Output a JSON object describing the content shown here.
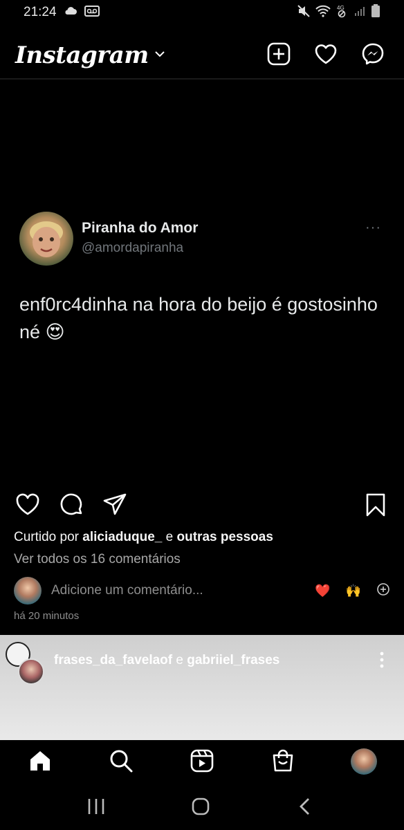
{
  "status_bar": {
    "time": "21:24",
    "network": "4G"
  },
  "header": {
    "logo": "Instagram",
    "icons": [
      "chevron-down-icon",
      "new-post-icon",
      "heart-icon",
      "messenger-icon"
    ]
  },
  "post": {
    "tweet": {
      "name": "Piranha do Amor",
      "handle": "@amordapiranha",
      "more": "···",
      "text": "enf0rc4dinha na hora do beijo é gostosinho né 😍"
    },
    "likes": {
      "prefix": "Curtido por ",
      "user": "aliciaduque_",
      "conjunction": " e ",
      "others": "outras pessoas"
    },
    "view_comments": "Ver todos os 16 comentários",
    "comment_placeholder": "Adicione um comentário...",
    "quick_emojis": [
      "❤️",
      "🙌"
    ],
    "timestamp": "há 20 minutos"
  },
  "next_post": {
    "user1": "frases_da_favelaof",
    "conjunction": " e ",
    "user2": "gabriiel_frases"
  },
  "colors": {
    "background": "#000000",
    "muted_text": "#a8a8a8",
    "like_red": "#ed4956"
  }
}
